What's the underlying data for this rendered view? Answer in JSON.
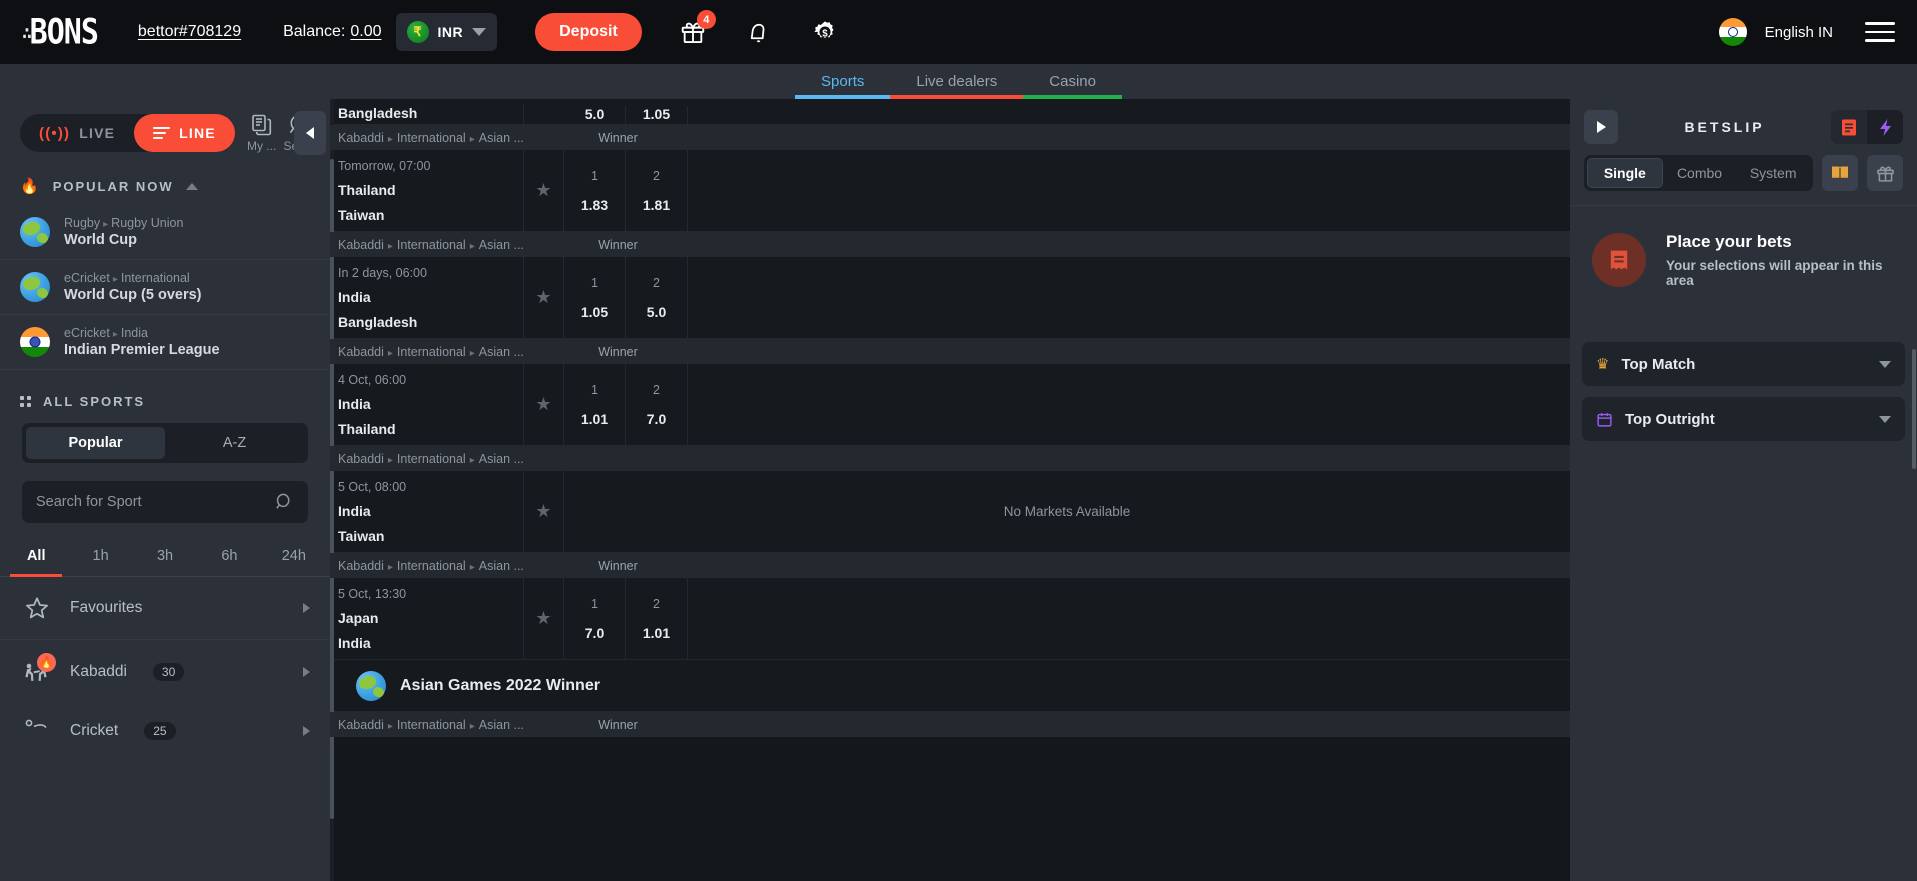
{
  "header": {
    "logo": "BONS",
    "username": "bettor#708129",
    "balance_label": "Balance:",
    "balance_amount": "0.00",
    "currency": "INR",
    "currency_symbol": "₹",
    "deposit_label": "Deposit",
    "gift_badge": "4",
    "language": "English IN",
    "icons": [
      "gift-icon",
      "bell-icon",
      "gear-dollar-icon",
      "hamburger-icon"
    ]
  },
  "nav": {
    "tabs": [
      {
        "label": "Sports",
        "active": true
      },
      {
        "label": "Live dealers",
        "active": false
      },
      {
        "label": "Casino",
        "active": false
      }
    ]
  },
  "sidebar": {
    "mode": {
      "live_label": "LIVE",
      "line_label": "LINE",
      "active": "LINE"
    },
    "my_bets_label": "My ...",
    "search_label": "Sea...",
    "popular_now": {
      "title": "POPULAR NOW",
      "items": [
        {
          "meta_sport": "Rugby",
          "meta_region": "Rugby Union",
          "title": "World Cup",
          "icon": "globe-icon"
        },
        {
          "meta_sport": "eCricket",
          "meta_region": "International",
          "title": "World Cup (5 overs)",
          "icon": "globe-icon"
        },
        {
          "meta_sport": "eCricket",
          "meta_region": "India",
          "title": "Indian Premier League",
          "icon": "india-flag-icon"
        }
      ]
    },
    "all_sports": {
      "title": "ALL SPORTS",
      "tabs": [
        {
          "label": "Popular",
          "active": true
        },
        {
          "label": "A-Z",
          "active": false
        }
      ],
      "search_placeholder": "Search for Sport",
      "search_value": "",
      "time_filters": [
        {
          "label": "All",
          "active": true
        },
        {
          "label": "1h",
          "active": false
        },
        {
          "label": "3h",
          "active": false
        },
        {
          "label": "6h",
          "active": false
        },
        {
          "label": "24h",
          "active": false
        }
      ],
      "sports": [
        {
          "name": "Favourites",
          "icon": "star-icon",
          "count": "",
          "hot": false
        },
        {
          "name": "Kabaddi",
          "icon": "kabaddi-icon",
          "count": "30",
          "hot": true
        },
        {
          "name": "Cricket",
          "icon": "cricket-icon",
          "count": "25",
          "hot": false
        }
      ]
    }
  },
  "main": {
    "partial_top_row": {
      "team": "Bangladesh",
      "odd_1": "5.0",
      "odd_2": "1.05"
    },
    "league_label_sport": "Kabaddi",
    "league_label_region": "International",
    "league_label_tournament": "Asian ...",
    "market_label": "Winner",
    "no_markets_label": "No Markets Available",
    "odd_header_1": "1",
    "odd_header_2": "2",
    "matches": [
      {
        "time": "Tomorrow, 07:00",
        "team1": "Thailand",
        "team2": "Taiwan",
        "odd1": "1.83",
        "odd2": "1.81",
        "has_markets": true
      },
      {
        "time": "In 2 days, 06:00",
        "team1": "India",
        "team2": "Bangladesh",
        "odd1": "1.05",
        "odd2": "5.0",
        "has_markets": true
      },
      {
        "time": "4 Oct, 06:00",
        "team1": "India",
        "team2": "Thailand",
        "odd1": "1.01",
        "odd2": "7.0",
        "has_markets": true
      },
      {
        "time": "5 Oct, 08:00",
        "team1": "India",
        "team2": "Taiwan",
        "odd1": "",
        "odd2": "",
        "has_markets": false
      },
      {
        "time": "5 Oct, 13:30",
        "team1": "Japan",
        "team2": "India",
        "odd1": "7.0",
        "odd2": "1.01",
        "has_markets": true
      }
    ],
    "outright_group": {
      "title": "Asian Games 2022 Winner",
      "icon": "globe-icon"
    }
  },
  "betslip": {
    "title": "BETSLIP",
    "tabs": [
      {
        "label": "Single",
        "active": true
      },
      {
        "label": "Combo",
        "active": false
      },
      {
        "label": "System",
        "active": false
      }
    ],
    "empty_title": "Place your bets",
    "empty_subtitle": "Your selections will appear in this area",
    "panels": [
      {
        "title": "Top Match",
        "icon": "crown-icon"
      },
      {
        "title": "Top Outright",
        "icon": "calendar-icon"
      }
    ]
  },
  "colors": {
    "accent": "#fa4d38",
    "sports_tab": "#59b9f0",
    "live_dealers_tab": "#fa4d38",
    "casino_tab": "#22b04b",
    "sidebar_bg": "#2b3039",
    "content_bg": "#14171c"
  }
}
